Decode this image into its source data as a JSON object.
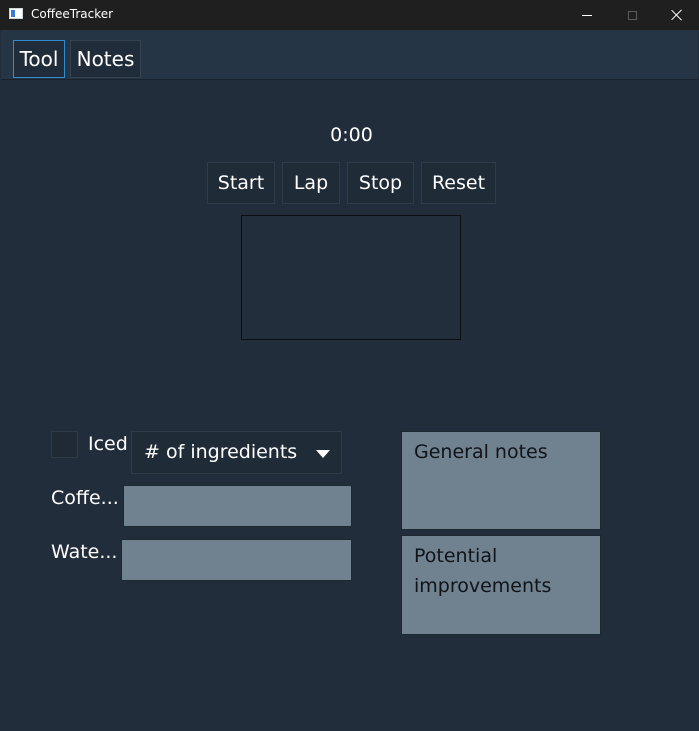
{
  "window": {
    "title": "CoffeeTracker",
    "icon": "app-window-icon",
    "controls": [
      "minimize-icon",
      "maximize-icon",
      "close-icon"
    ]
  },
  "tabs": [
    {
      "label": "Tool",
      "selected": true
    },
    {
      "label": "Notes",
      "selected": false
    }
  ],
  "timer": {
    "display": "0:00",
    "buttons": {
      "start": "Start",
      "lap": "Lap",
      "stop": "Stop",
      "reset": "Reset"
    }
  },
  "recipe": {
    "iced_label": "Iced",
    "iced_checked": false,
    "ingredients_dropdown": {
      "value": "# of ingredients"
    },
    "fields": {
      "coffee_label": "Coffe...",
      "coffee_value": "",
      "water_label": "Wate...",
      "water_value": ""
    }
  },
  "notes": {
    "general_placeholder": "General notes",
    "improvements_placeholder": "Potential improvements"
  },
  "colors": {
    "background": "#212d3a",
    "tab_accent": "#2f8cd0",
    "field_fill": "#708190"
  }
}
